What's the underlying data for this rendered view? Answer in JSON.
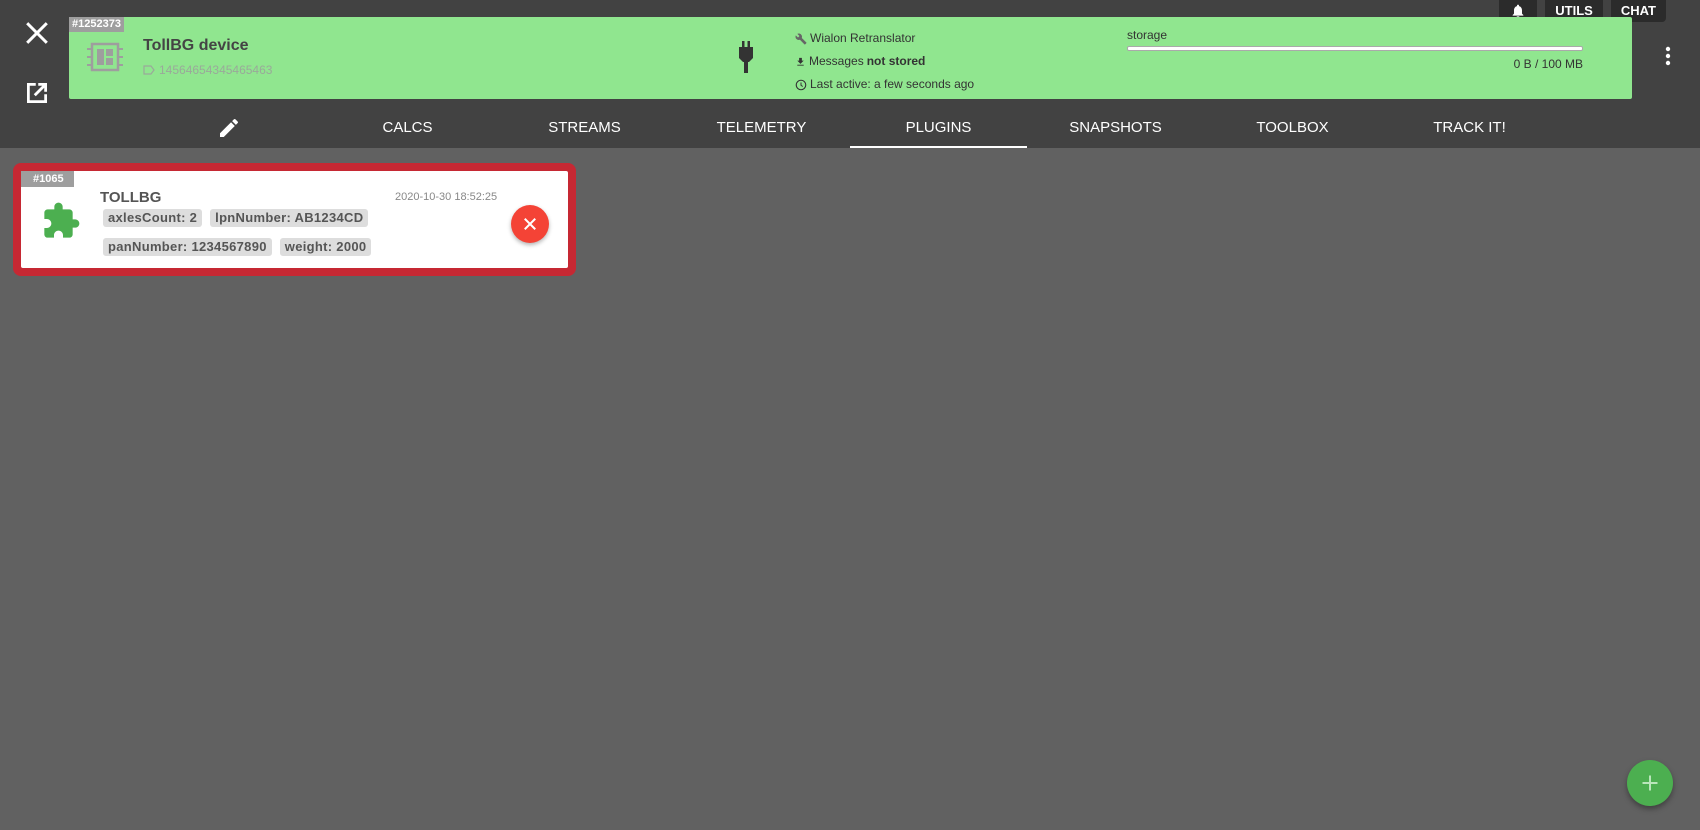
{
  "device": {
    "id_tag": "#1252373",
    "name": "TollBG device",
    "ident": "14564654345465463",
    "protocol": "Wialon Retranslator",
    "messages_prefix": "Messages",
    "messages_status": "not stored",
    "last_active": "Last active: a few seconds ago",
    "storage_label": "storage",
    "storage_size": "0 B / 100 MB",
    "storage_fraction": 0,
    "color": "#90e68f"
  },
  "utils": {
    "utils_label": "UTILS",
    "chat_label": "CHAT"
  },
  "tabs": [
    {
      "label": "CALCS"
    },
    {
      "label": "STREAMS"
    },
    {
      "label": "TELEMETRY"
    },
    {
      "label": "PLUGINS"
    },
    {
      "label": "SNAPSHOTS"
    },
    {
      "label": "TOOLBOX"
    },
    {
      "label": "TRACK IT!"
    }
  ],
  "active_tab": "PLUGINS",
  "plugin": {
    "id_tag": "#1065",
    "title": "TOLLBG",
    "date": "2020-10-30 18:52:25",
    "fields": [
      [
        "axlesCount: 2",
        "lpnNumber: AB1234CD"
      ],
      [
        "panNumber: 1234567890",
        "weight: 2000"
      ]
    ],
    "icon_color": "#4caf50",
    "delete_color": "#f44336",
    "highlight_color": "#c62833"
  },
  "icons": {
    "close": "close-icon",
    "open_external": "open-external-icon",
    "bell": "bell-icon",
    "menu": "more-vert-icon",
    "chip": "chip-icon",
    "plug": "plug-icon",
    "edit": "pencil-icon",
    "puzzle": "puzzle-icon",
    "add": "plus-icon"
  }
}
